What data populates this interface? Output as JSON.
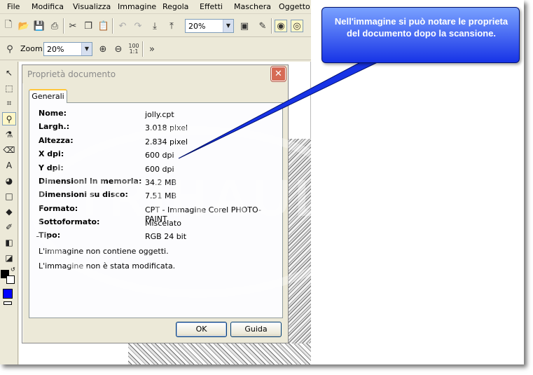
{
  "menu": [
    "File",
    "Modifica",
    "Visualizza",
    "Immagine",
    "Regola",
    "Effetti",
    "Maschera",
    "Oggetto"
  ],
  "toolbar1": {
    "zoom_value": "20%"
  },
  "toolbar2": {
    "zoom_label": "Zoom",
    "zoom_value": "20%",
    "zoom_100": "100",
    "zoom_100_sub": "1:1"
  },
  "dialog": {
    "title": "Proprietà documento",
    "tab": "Generali",
    "properties": [
      {
        "label": "Nome:",
        "value": "jolly.cpt"
      },
      {
        "label": "Largh.:",
        "value": "3.018 pixel"
      },
      {
        "label": "Altezza:",
        "value": "2.834 pixel"
      },
      {
        "label": "X dpi:",
        "value": "600 dpi"
      },
      {
        "label": "Y dpi:",
        "value": "600 dpi"
      },
      {
        "label": "Dimensioni in memoria:",
        "value": "34.2 MB"
      },
      {
        "label": "Dimensioni su disco:",
        "value": "7.51 MB"
      },
      {
        "label": "Formato:",
        "value": "CPT - Immagine Corel PHOTO-PAINT"
      },
      {
        "label": "Sottoformato:",
        "value": "Miscelato"
      },
      {
        "label": "Tipo:",
        "value": "RGB 24 bit"
      }
    ],
    "notes": [
      "L'immagine non contiene oggetti.",
      "L'immagine non è stata modificata."
    ],
    "ok_label": "OK",
    "help_label": "Guida"
  },
  "callout": {
    "text": "Nell'immagine si può notare le proprieta del documento dopo la scansione."
  },
  "watermark": {
    "text": "TRIHAUL"
  },
  "colors": {
    "accent_blue": "#1733e6",
    "primary_color": "#0000ff",
    "close_button": "#d66b55",
    "tab_highlight": "#ffc73c"
  }
}
